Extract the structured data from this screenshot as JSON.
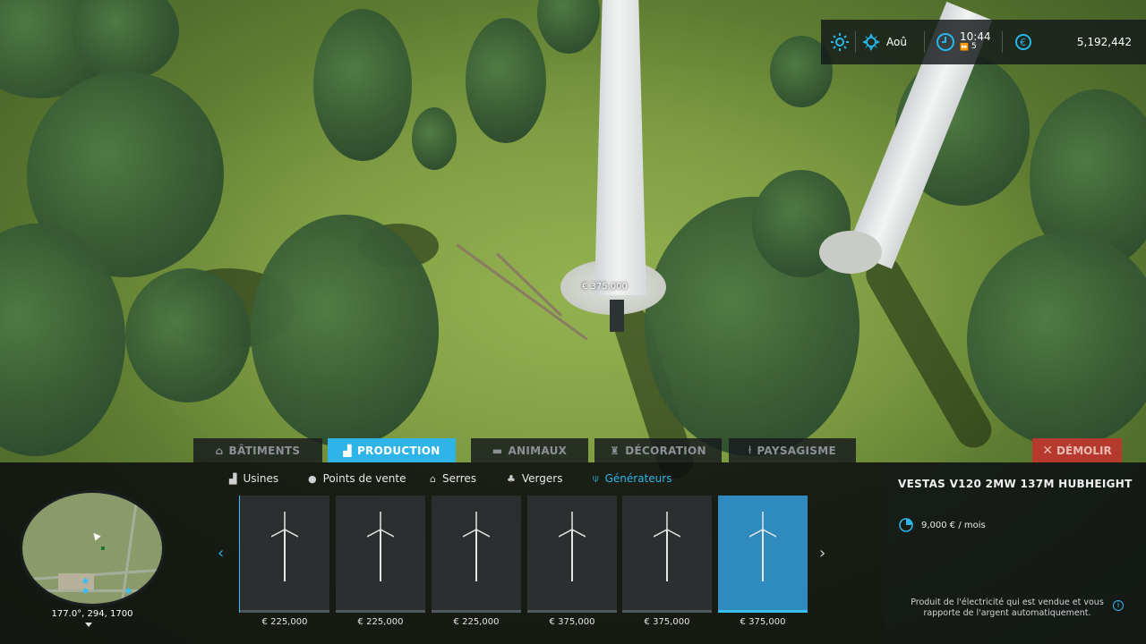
{
  "hud": {
    "weather_icon": "sun-icon",
    "season_icon": "sun-gear-icon",
    "month": "Aoû",
    "time": "10:44",
    "speed": "5",
    "currency_symbol": "€",
    "money": "5,192,442"
  },
  "world": {
    "placement_price": "€ 375,000"
  },
  "categories": [
    {
      "label": "BÂTIMENTS",
      "icon": "barn-icon",
      "active": false
    },
    {
      "label": "PRODUCTION",
      "icon": "factory-icon",
      "active": true
    },
    {
      "label": "ANIMAUX",
      "icon": "cow-icon",
      "active": false
    },
    {
      "label": "DÉCORATION",
      "icon": "statue-icon",
      "active": false
    },
    {
      "label": "PAYSAGISME",
      "icon": "shovel-icon",
      "active": false
    }
  ],
  "demolish_label": "DÉMOLIR",
  "subtabs": [
    {
      "label": "Usines",
      "icon": "factory-icon",
      "active": false
    },
    {
      "label": "Points de vente",
      "icon": "coin-icon",
      "active": false
    },
    {
      "label": "Serres",
      "icon": "greenhouse-icon",
      "active": false
    },
    {
      "label": "Vergers",
      "icon": "orchard-icon",
      "active": false
    },
    {
      "label": "Générateurs",
      "icon": "wind-turbine-icon",
      "active": true
    }
  ],
  "items": [
    {
      "price": "€ 225,000",
      "selected": false
    },
    {
      "price": "€ 225,000",
      "selected": false
    },
    {
      "price": "€ 225,000",
      "selected": false
    },
    {
      "price": "€ 375,000",
      "selected": false
    },
    {
      "price": "€ 375,000",
      "selected": false
    },
    {
      "price": "€ 375,000",
      "selected": true
    }
  ],
  "minimap": {
    "coords": "177.0°, 294, 1700"
  },
  "detail": {
    "title": "VESTAS V120 2MW 137M HUBHEIGHT",
    "cost": "9,000 € / mois",
    "description": "Produit de l'électricité qui est vendue et vous rapporte de l'argent automatiquement.",
    "info_icon": "i"
  },
  "colors": {
    "accent": "#2eb4e6",
    "demolish": "#b53a2d"
  }
}
